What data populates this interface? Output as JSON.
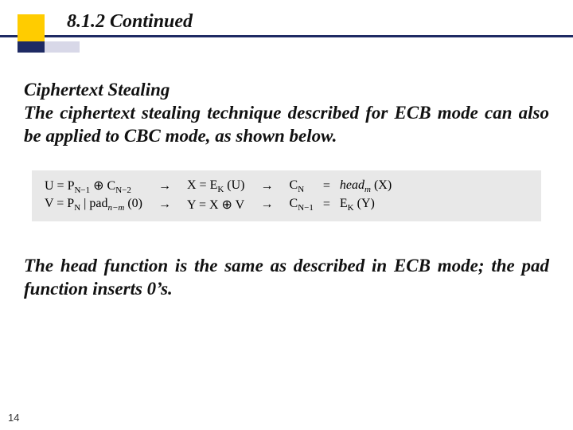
{
  "heading": "8.1.2  Continued",
  "section_title": "Ciphertext Stealing",
  "para1": "The ciphertext stealing technique described for ECB mode can also be applied to CBC mode, as shown below.",
  "para2": "The head function is the same as described in ECB mode; the pad function inserts 0’s.",
  "page_number": "14",
  "formula": {
    "row1": {
      "lhs": "U = P",
      "lhs_sub": "N−1",
      "op": " ⊕ C",
      "op_sub": "N−2",
      "mid": "X = E",
      "mid_sub": "K",
      "mid_tail": " (U)",
      "rhs_l": "C",
      "rhs_l_sub": "N",
      "rhs_eq": "=",
      "rhs_r_pre": "head",
      "rhs_r_sub": "m",
      "rhs_r_tail": " (X)"
    },
    "row2": {
      "lhs": "V = P",
      "lhs_sub": "N",
      "op": " | pad",
      "op_sub": "n−m",
      "op_tail": " (0)",
      "mid": "Y = X ⊕ V",
      "rhs_l": "C",
      "rhs_l_sub": "N−1",
      "rhs_eq": "=",
      "rhs_r_pre": "E",
      "rhs_r_sub": "K",
      "rhs_r_tail": " (Y)"
    },
    "arrow": "→"
  }
}
